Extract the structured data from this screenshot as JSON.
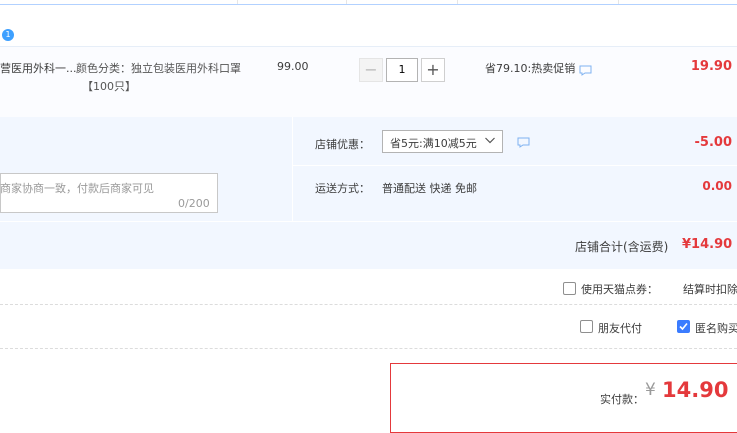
{
  "header": {
    "badge": "1"
  },
  "item": {
    "title": "营医用外科一...",
    "sku_label": "颜色分类：独立包装医用外科口罩",
    "sku_suffix": "【100只】",
    "unit_price": "99.00",
    "quantity": "1",
    "qty_minus": "−",
    "qty_plus": "+",
    "promo": "省79.10:热卖促销",
    "total": "19.90"
  },
  "shop": {
    "remark_placeholder": "商家协商一致，付款后商家可见",
    "remark_count": "0/200",
    "coupon_label": "店铺优惠：",
    "coupon_selected": "省5元:满10减5元",
    "coupon_amount": "-5.00",
    "shipping_label": "运送方式：",
    "shipping_value": "普通配送 快递 免邮",
    "shipping_amount": "0.00",
    "total_label": "店铺合计(含运费)",
    "total_value": "¥14.90"
  },
  "options": {
    "tmall_coupon_label": "使用天猫点券：",
    "tmall_coupon_value": "结算时扣除",
    "tmall_checked": false,
    "friend_pay_label": "朋友代付",
    "friend_pay_checked": false,
    "anonymous_label": "匿名购买",
    "anonymous_checked": true
  },
  "payment": {
    "label": "实付款：",
    "currency": "¥",
    "amount": "14.90"
  },
  "colors": {
    "price_red": "#e4393c",
    "accent_blue": "#3b7cff",
    "panel_bg": "#f2f7ff"
  }
}
